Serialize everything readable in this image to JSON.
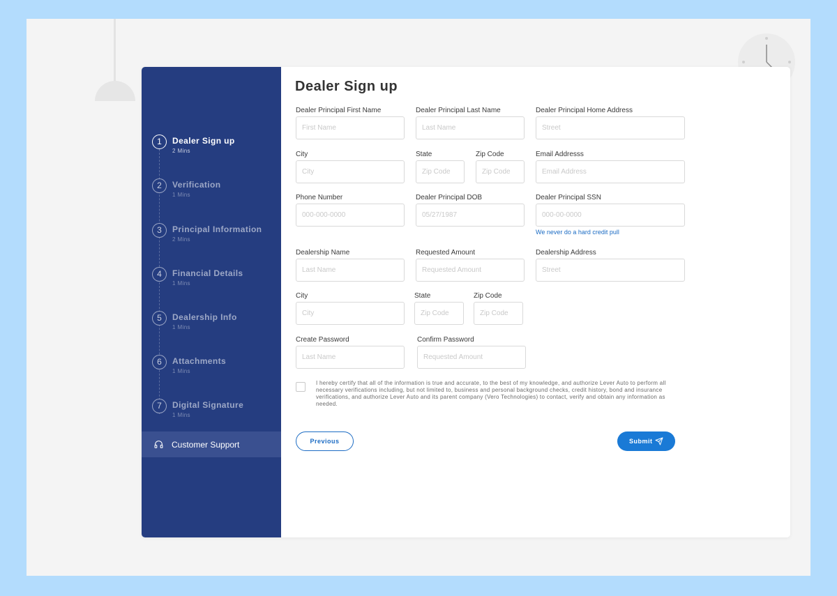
{
  "colors": {
    "sidebar": "#253d80",
    "accent": "#1a7ad6",
    "page_bg": "#b3dcfd",
    "canvas_bg": "#f4f4f4"
  },
  "sidebar": {
    "steps": [
      {
        "num": "1",
        "title": "Dealer Sign up",
        "sub": "2 Mins",
        "active": true
      },
      {
        "num": "2",
        "title": "Verification",
        "sub": "1 Mins",
        "active": false
      },
      {
        "num": "3",
        "title": "Principal Information",
        "sub": "2 Mins",
        "active": false
      },
      {
        "num": "4",
        "title": "Financial Details",
        "sub": "1 Mins",
        "active": false
      },
      {
        "num": "5",
        "title": "Dealership Info",
        "sub": "1 Mins",
        "active": false
      },
      {
        "num": "6",
        "title": "Attachments",
        "sub": "1 Mins",
        "active": false
      },
      {
        "num": "7",
        "title": "Digital Signature",
        "sub": "1 Mins",
        "active": false
      }
    ],
    "support": {
      "label": "Customer Support",
      "icon": "headphones-icon"
    }
  },
  "form": {
    "title": "Dealer Sign up",
    "fields": {
      "first_name": {
        "label": "Dealer Principal First Name",
        "placeholder": "First Name"
      },
      "last_name": {
        "label": "Dealer Principal Last Name",
        "placeholder": "Last Name"
      },
      "home_address": {
        "label": "Dealer Principal Home Address",
        "placeholder": "Street"
      },
      "city": {
        "label": "City",
        "placeholder": "City"
      },
      "state": {
        "label": "State",
        "placeholder": "Zip Code"
      },
      "zip": {
        "label": "Zip Code",
        "placeholder": "Zip Code"
      },
      "email": {
        "label": "Email Addresss",
        "placeholder": "Email Address"
      },
      "phone": {
        "label": "Phone Number",
        "placeholder": "000-000-0000"
      },
      "dob": {
        "label": "Dealer Principal DOB",
        "placeholder": "05/27/1987"
      },
      "ssn": {
        "label": "Dealer Principal SSN",
        "placeholder": "000-00-0000",
        "hint": "We never do a hard credit pull"
      },
      "dealership_name": {
        "label": "Dealership Name",
        "placeholder": "Last Name"
      },
      "requested_amount": {
        "label": "Requested Amount",
        "placeholder": "Requested Amount"
      },
      "dealership_address": {
        "label": "Dealership Address",
        "placeholder": "Street"
      },
      "city2": {
        "label": "City",
        "placeholder": "City"
      },
      "state2": {
        "label": "State",
        "placeholder": "Zip Code"
      },
      "zip2": {
        "label": "Zip Code",
        "placeholder": "Zip Code"
      },
      "create_password": {
        "label": "Create Password",
        "placeholder": "Last Name"
      },
      "confirm_password": {
        "label": "Confirm Password",
        "placeholder": "Requested Amount"
      }
    },
    "certify_text": "I hereby certify that all of the information is true and accurate, to the best of my knowledge, and authorize Lever Auto to perform all necessary verifications including, but not limited to, business and personal background checks, credit history, bond and insurance verifications, and authorize Lever Auto and its parent company (Vero Technologies) to contact, verify and obtain any information as needed.",
    "certify_checked": false,
    "previous_label": "Previous",
    "submit_label": "Submit",
    "submit_icon": "send-icon"
  }
}
